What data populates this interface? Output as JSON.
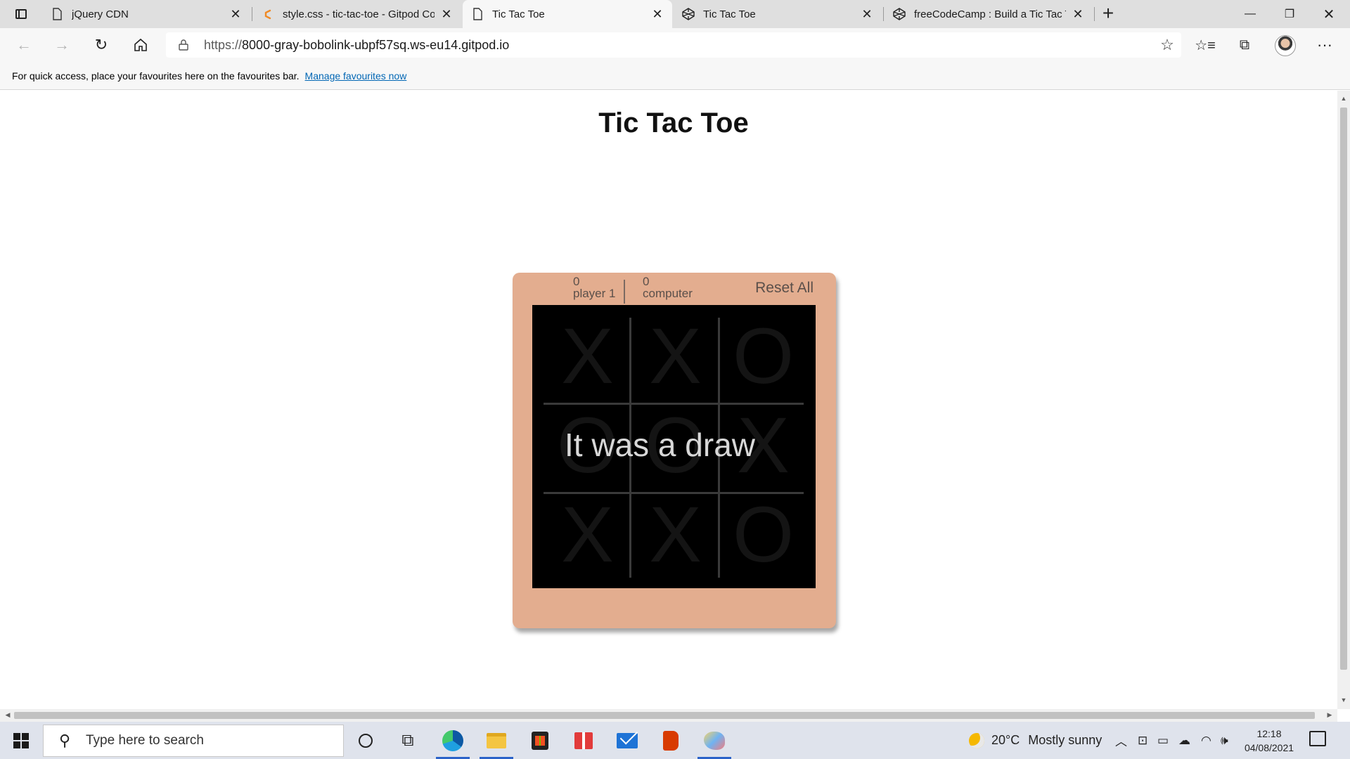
{
  "browser": {
    "tabs": [
      {
        "title": "jQuery CDN",
        "active": false,
        "icon": "page-icon"
      },
      {
        "title": "style.css - tic-tac-toe - Gitpod Co",
        "active": false,
        "icon": "gitpod-icon"
      },
      {
        "title": "Tic Tac Toe",
        "active": true,
        "icon": "page-icon"
      },
      {
        "title": "Tic Tac Toe",
        "active": false,
        "icon": "codepen-icon"
      },
      {
        "title": "freeCodeCamp : Build a Tic Tac To",
        "active": false,
        "icon": "codepen-icon"
      }
    ],
    "url_scheme": "https://",
    "url_host": "8000-gray-bobolink-ubpf57sq.ws-eu14.gitpod.io",
    "favbar_text": "For quick access, place your favourites here on the favourites bar.",
    "favbar_link": "Manage favourites now"
  },
  "page": {
    "title": "Tic Tac Toe",
    "game": {
      "player1": {
        "score": "0",
        "label": "player 1"
      },
      "computer": {
        "score": "0",
        "label": "computer"
      },
      "reset_label": "Reset All",
      "board": [
        "X",
        "X",
        "O",
        "O",
        "O",
        "X",
        "X",
        "X",
        "O"
      ],
      "result": "It was a draw",
      "colors": {
        "panel": "#e3ad8f",
        "board": "#000000",
        "result_text": "#d8d8d8"
      }
    }
  },
  "taskbar": {
    "search_placeholder": "Type here to search",
    "weather_temp": "20°C",
    "weather_desc": "Mostly sunny",
    "time": "12:18",
    "date": "04/08/2021"
  }
}
